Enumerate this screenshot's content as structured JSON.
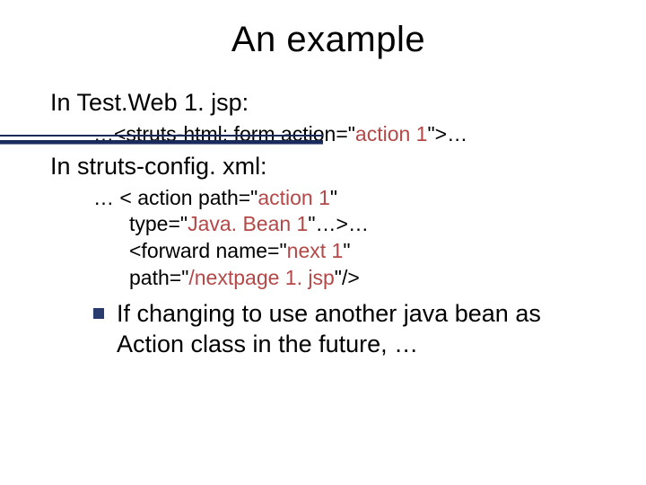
{
  "title": "An example",
  "line1": "In Test.Web 1. jsp:",
  "line2_pre": "…<struts-html: form action=\"",
  "line2_hl": "action 1",
  "line2_post": "\">…",
  "line3": "In struts-config. xml:",
  "line4_pre": "… < action path=\"",
  "line4_hl": "action 1",
  "line4_post": "\"",
  "line5_pre": "type=\"",
  "line5_hl": "Java. Bean 1",
  "line5_post": "\"…>…",
  "line6_pre": "<forward name=\"",
  "line6_hl": "next 1",
  "line6_post": "\"",
  "line7_pre": "path=\"",
  "line7_hl": "/nextpage 1. jsp",
  "line7_post": "\"/>",
  "bullet": "If changing to use another java bean as Action class in the future, …"
}
